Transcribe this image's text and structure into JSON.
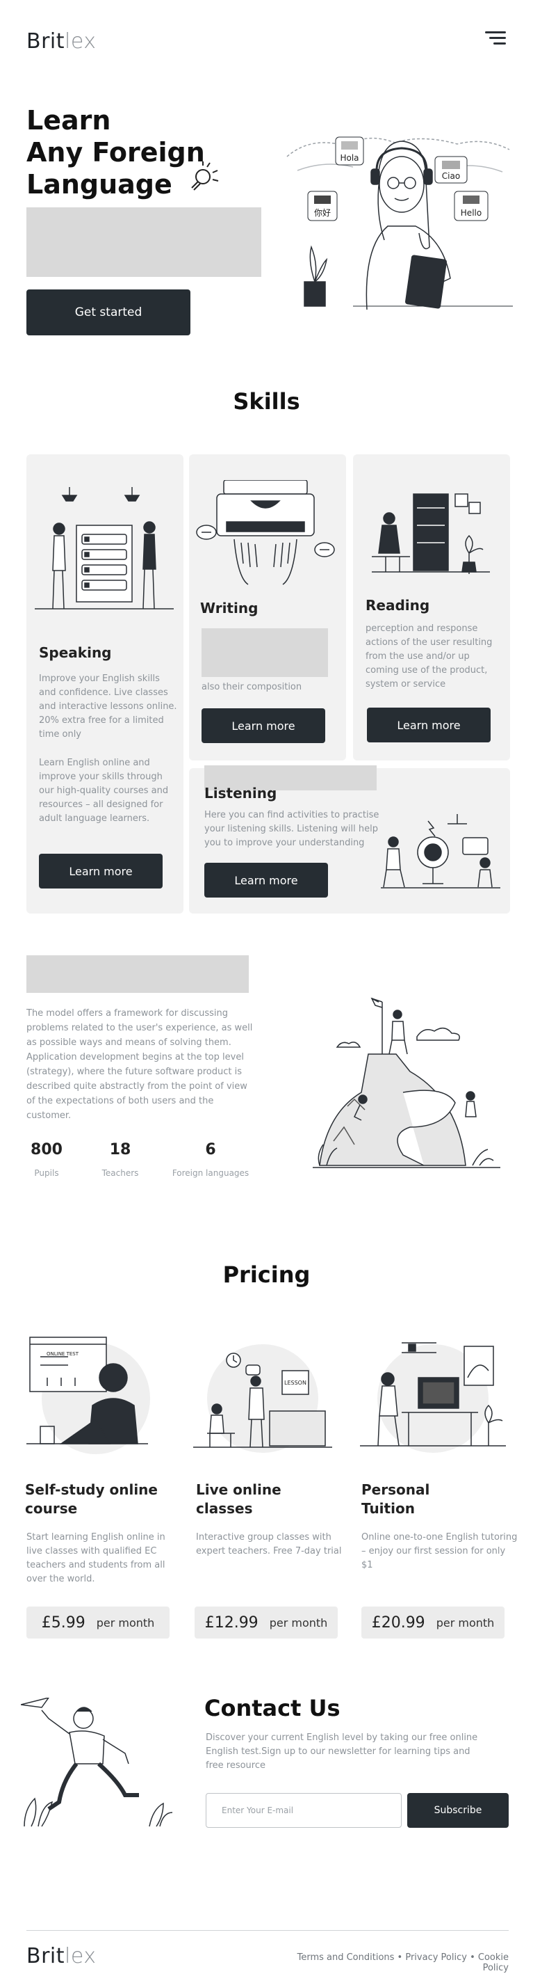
{
  "brand": {
    "name_dark": "Brit",
    "name_light": "lex"
  },
  "hero": {
    "title": "Learn\nAny Foreign\nLanguage",
    "cta": "Get started",
    "bubbles": [
      "Hola",
      "Ciao",
      "你好",
      "Hello"
    ]
  },
  "skills": {
    "title": "Skills",
    "speaking": {
      "title": "Speaking",
      "text1": "Improve your English skills and confidence. Live classes and interactive lessons online. 20% extra free for a limited time only",
      "text2": "Learn English online and improve your skills through our high-quality courses and resources – all designed for adult language learners.",
      "button": "Learn more"
    },
    "writing": {
      "title": "Writing",
      "text": "also their composition",
      "button": "Learn more"
    },
    "reading": {
      "title": "Reading",
      "text": "perception and response actions of the user resulting from the use and/or up coming use of the product, system or service",
      "button": "Learn more"
    },
    "listening": {
      "title": "Listening",
      "text": "Here you can find activities to practise your listening skills. Listening will help you to improve your understanding",
      "button": "Learn more"
    }
  },
  "about": {
    "text": "The model offers a framework for discussing problems related to the user's experience, as well as possible ways and means of solving them. Application development begins at the top level (strategy), where the future software product is described quite abstractly from the point of view of the expectations of both users and the customer.",
    "stats": [
      {
        "value": "800",
        "label": "Pupils"
      },
      {
        "value": "18",
        "label": "Teachers"
      },
      {
        "value": "6",
        "label": "Foreign languages"
      }
    ]
  },
  "pricing": {
    "title": "Pricing",
    "plans": [
      {
        "title": "Self-study online course",
        "text": "Start learning English online in live classes with qualified EC teachers and students from all over the world.",
        "price": "£5.99",
        "period": "per month"
      },
      {
        "title": "Live online classes",
        "text": "Interactive group classes with expert teachers. Free 7-day trial",
        "price": "£12.99",
        "period": "per month"
      },
      {
        "title": "Personal Tuition",
        "text": "Online one-to-one English tutoring – enjoy our first session for only $1",
        "price": "£20.99",
        "period": "per month"
      }
    ],
    "board_label": "ONLINE TEST",
    "lesson_label": "LESSON"
  },
  "contact": {
    "title": "Contact Us",
    "text": "Discover your current English level by taking our free online English test.Sign up to our newsletter for learning tips and free resource",
    "email_placeholder": "Enter Your E-mail",
    "subscribe": "Subscribe"
  },
  "footer": {
    "links": "Terms and Conditions • Privacy Policy • Cookie Policy"
  }
}
